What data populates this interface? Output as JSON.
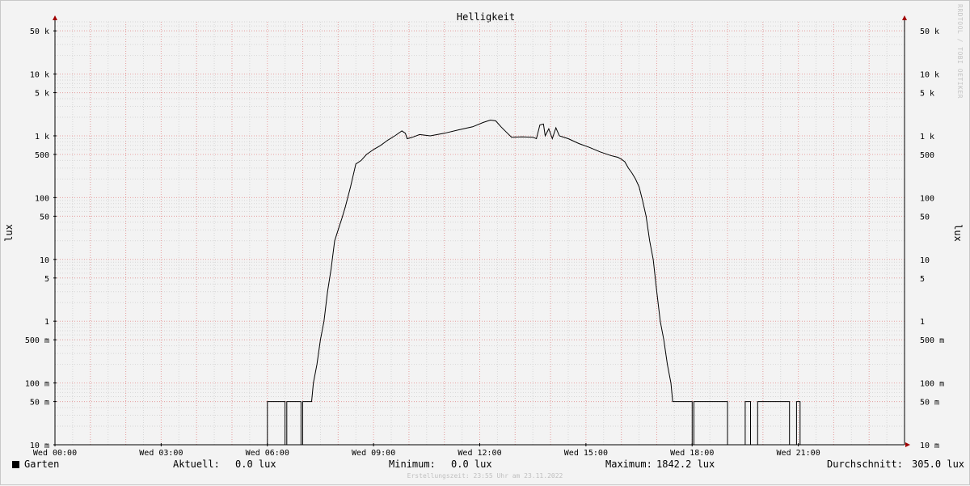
{
  "chart_data": {
    "type": "line",
    "title": "Helligkeit",
    "ylabel": "lux",
    "yscale": "log",
    "ylim": [
      0.01,
      70000
    ],
    "xlim": [
      0,
      24
    ],
    "x_unit": "hours",
    "y_ticks": [
      {
        "value": 0.01,
        "label": "10 m"
      },
      {
        "value": 0.05,
        "label": "50 m"
      },
      {
        "value": 0.1,
        "label": "100 m"
      },
      {
        "value": 0.5,
        "label": "500 m"
      },
      {
        "value": 1,
        "label": "1"
      },
      {
        "value": 5,
        "label": "5"
      },
      {
        "value": 10,
        "label": "10"
      },
      {
        "value": 50,
        "label": "50"
      },
      {
        "value": 100,
        "label": "100"
      },
      {
        "value": 500,
        "label": "500"
      },
      {
        "value": 1000,
        "label": "1 k"
      },
      {
        "value": 5000,
        "label": "5 k"
      },
      {
        "value": 10000,
        "label": "10 k"
      },
      {
        "value": 50000,
        "label": "50 k"
      }
    ],
    "x_ticks": [
      {
        "value": 0,
        "label": "Wed 00:00"
      },
      {
        "value": 3,
        "label": "Wed 03:00"
      },
      {
        "value": 6,
        "label": "Wed 06:00"
      },
      {
        "value": 9,
        "label": "Wed 09:00"
      },
      {
        "value": 12,
        "label": "Wed 12:00"
      },
      {
        "value": 15,
        "label": "Wed 15:00"
      },
      {
        "value": 18,
        "label": "Wed 18:00"
      },
      {
        "value": 21,
        "label": "Wed 21:00"
      }
    ],
    "grid": true,
    "series": [
      {
        "name": "Garten",
        "color": "#000000",
        "points": [
          [
            0,
            0.01
          ],
          [
            6.0,
            0.01
          ],
          [
            6.0,
            0.05
          ],
          [
            6.5,
            0.05
          ],
          [
            6.5,
            0.01
          ],
          [
            6.55,
            0.01
          ],
          [
            6.55,
            0.05
          ],
          [
            6.95,
            0.05
          ],
          [
            6.95,
            0.01
          ],
          [
            7.0,
            0.01
          ],
          [
            7.0,
            0.05
          ],
          [
            7.25,
            0.05
          ],
          [
            7.3,
            0.1
          ],
          [
            7.4,
            0.2
          ],
          [
            7.5,
            0.5
          ],
          [
            7.6,
            1
          ],
          [
            7.7,
            3
          ],
          [
            7.8,
            7
          ],
          [
            7.9,
            20
          ],
          [
            8.0,
            30
          ],
          [
            8.1,
            45
          ],
          [
            8.2,
            70
          ],
          [
            8.35,
            150
          ],
          [
            8.5,
            350
          ],
          [
            8.65,
            400
          ],
          [
            8.8,
            500
          ],
          [
            9.0,
            600
          ],
          [
            9.2,
            700
          ],
          [
            9.4,
            850
          ],
          [
            9.6,
            1000
          ],
          [
            9.8,
            1200
          ],
          [
            9.9,
            1100
          ],
          [
            9.95,
            900
          ],
          [
            10.1,
            950
          ],
          [
            10.3,
            1050
          ],
          [
            10.6,
            1000
          ],
          [
            11.0,
            1100
          ],
          [
            11.4,
            1250
          ],
          [
            11.8,
            1400
          ],
          [
            12.1,
            1650
          ],
          [
            12.3,
            1800
          ],
          [
            12.45,
            1750
          ],
          [
            12.6,
            1400
          ],
          [
            12.75,
            1150
          ],
          [
            12.9,
            950
          ],
          [
            13.2,
            960
          ],
          [
            13.5,
            950
          ],
          [
            13.6,
            900
          ],
          [
            13.7,
            1500
          ],
          [
            13.8,
            1550
          ],
          [
            13.85,
            1000
          ],
          [
            13.95,
            1300
          ],
          [
            14.05,
            900
          ],
          [
            14.15,
            1350
          ],
          [
            14.25,
            1000
          ],
          [
            14.5,
            900
          ],
          [
            14.8,
            750
          ],
          [
            15.1,
            650
          ],
          [
            15.4,
            550
          ],
          [
            15.7,
            480
          ],
          [
            15.9,
            450
          ],
          [
            16.0,
            420
          ],
          [
            16.1,
            380
          ],
          [
            16.2,
            300
          ],
          [
            16.3,
            250
          ],
          [
            16.4,
            200
          ],
          [
            16.5,
            150
          ],
          [
            16.6,
            90
          ],
          [
            16.7,
            50
          ],
          [
            16.8,
            20
          ],
          [
            16.9,
            10
          ],
          [
            17.0,
            3
          ],
          [
            17.1,
            1
          ],
          [
            17.2,
            0.5
          ],
          [
            17.3,
            0.2
          ],
          [
            17.4,
            0.1
          ],
          [
            17.45,
            0.05
          ],
          [
            18.0,
            0.05
          ],
          [
            18.0,
            0.01
          ],
          [
            18.05,
            0.01
          ],
          [
            18.05,
            0.05
          ],
          [
            19.0,
            0.05
          ],
          [
            19.0,
            0.01
          ],
          [
            19.5,
            0.01
          ],
          [
            19.5,
            0.05
          ],
          [
            19.65,
            0.05
          ],
          [
            19.65,
            0.01
          ],
          [
            19.85,
            0.01
          ],
          [
            19.85,
            0.05
          ],
          [
            20.75,
            0.05
          ],
          [
            20.75,
            0.01
          ],
          [
            20.95,
            0.01
          ],
          [
            20.95,
            0.05
          ],
          [
            21.05,
            0.05
          ],
          [
            21.05,
            0.01
          ],
          [
            24,
            0.01
          ]
        ]
      }
    ]
  },
  "legend": {
    "series_name": "Garten",
    "current_label": "Aktuell:",
    "current_value": "0.0 lux",
    "min_label": "Minimum:",
    "min_value": "0.0 lux",
    "max_label": "Maximum:",
    "max_value": "1842.2 lux",
    "avg_label": "Durchschnitt:",
    "avg_value": "305.0 lux"
  },
  "footer": "Erstellungszeit: 23:55 Uhr am 23.11.2022",
  "watermark": "RRDTOOL / TOBI OETIKER",
  "colors": {
    "major_grid": "#e8a0a0",
    "minor_grid": "#d6d6d6",
    "axis": "#000000",
    "arrow": "#a00000"
  }
}
